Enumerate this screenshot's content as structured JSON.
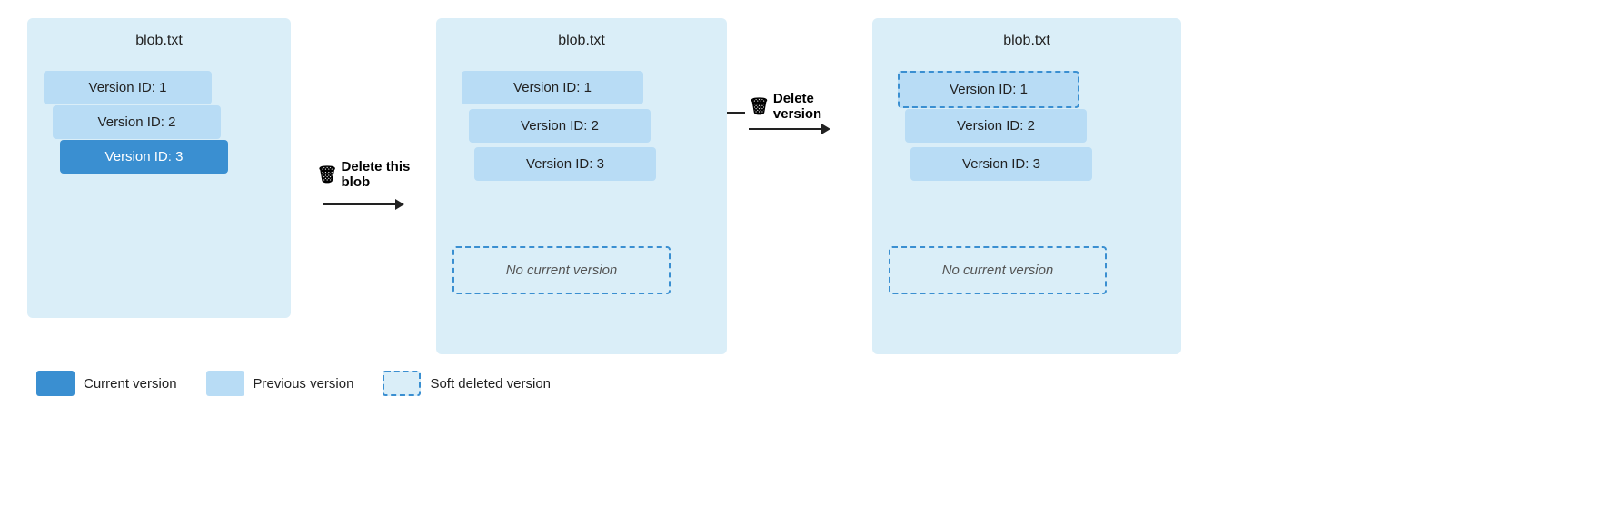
{
  "panels": [
    {
      "id": "panel1",
      "title": "blob.txt",
      "versions": [
        {
          "id": "v1",
          "label": "Version ID: 1",
          "type": "previous"
        },
        {
          "id": "v2",
          "label": "Version ID: 2",
          "type": "previous"
        },
        {
          "id": "v3",
          "label": "Version ID: 3",
          "type": "current"
        }
      ],
      "no_current": null
    },
    {
      "id": "panel2",
      "title": "blob.txt",
      "versions": [
        {
          "id": "v1",
          "label": "Version ID: 1",
          "type": "previous"
        },
        {
          "id": "v2",
          "label": "Version ID: 2",
          "type": "previous"
        },
        {
          "id": "v3",
          "label": "Version ID: 3",
          "type": "previous"
        }
      ],
      "no_current": "No current version"
    },
    {
      "id": "panel3",
      "title": "blob.txt",
      "versions": [
        {
          "id": "v1",
          "label": "Version ID: 1",
          "type": "soft-deleted"
        },
        {
          "id": "v2",
          "label": "Version ID: 2",
          "type": "previous"
        },
        {
          "id": "v3",
          "label": "Version ID: 3",
          "type": "previous"
        }
      ],
      "no_current": "No current version"
    }
  ],
  "connectors": [
    {
      "id": "c1",
      "icon": "🗑",
      "label": "Delete this\nblob",
      "arrow": true
    },
    {
      "id": "c2",
      "icon": "🗑",
      "label": "Delete\nversion",
      "arrow": true
    }
  ],
  "legend": [
    {
      "id": "l1",
      "type": "current",
      "label": "Current version"
    },
    {
      "id": "l2",
      "type": "previous",
      "label": "Previous version"
    },
    {
      "id": "l3",
      "type": "soft-deleted",
      "label": "Soft deleted version"
    }
  ]
}
